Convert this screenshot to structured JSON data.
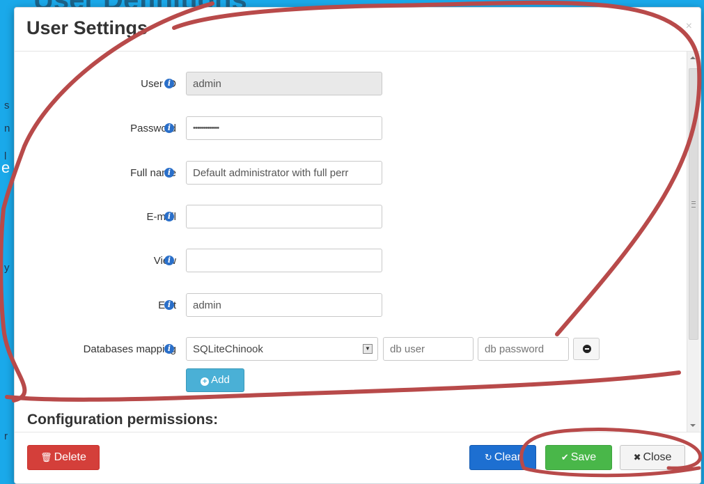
{
  "background": {
    "heading": "User Definitions",
    "fragments": [
      "s",
      "n",
      "e",
      "l",
      "y",
      "r"
    ]
  },
  "dialog": {
    "title": "User Settings",
    "close_icon": "×"
  },
  "form": {
    "user_id": {
      "label": "User ID",
      "value": "admin"
    },
    "password": {
      "label": "Password",
      "value": "•••••••••••••"
    },
    "full_name": {
      "label": "Full name",
      "value": "Default administrator with full perr"
    },
    "email": {
      "label": "E-mail",
      "value": ""
    },
    "view": {
      "label": "View",
      "value": ""
    },
    "edit": {
      "label": "Edit",
      "value": "admin"
    },
    "db_mapping": {
      "label": "Databases mapping",
      "selected": "SQLiteChinook",
      "db_user_placeholder": "db user",
      "db_password_placeholder": "db password"
    },
    "add_label": "Add",
    "section_title": "Configuration permissions:"
  },
  "footer": {
    "delete_label": "Delete",
    "clear_label": "Clear",
    "save_label": "Save",
    "close_label": "Close"
  },
  "icons": {
    "info": "info-circle-icon",
    "trash": "trash-icon",
    "refresh": "refresh-icon",
    "check": "check-icon",
    "times": "times-icon",
    "plus": "plus-circle-icon",
    "minus": "minus-circle-icon"
  },
  "colors": {
    "page_background": "#10a7e8",
    "annotation": "#b84a4a",
    "delete": "#d43f3a",
    "clear": "#1d6fd1",
    "save": "#49b749",
    "add": "#4ab0d6"
  }
}
